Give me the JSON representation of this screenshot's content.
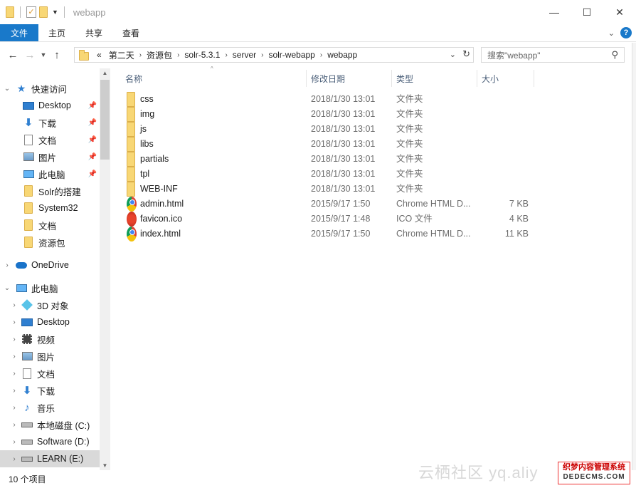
{
  "window": {
    "title": "webapp",
    "controls": {
      "minimize": "—",
      "maximize": "☐",
      "close": "✕"
    }
  },
  "ribbon": {
    "tabs": [
      "文件",
      "主页",
      "共享",
      "查看"
    ]
  },
  "address": {
    "overflow": "«",
    "path": [
      "第二天",
      "资源包",
      "solr-5.3.1",
      "server",
      "solr-webapp",
      "webapp"
    ]
  },
  "search": {
    "placeholder": "搜索\"webapp\""
  },
  "nav": {
    "quick_access": "快速访问",
    "quick_items": [
      {
        "label": "Desktop",
        "icon": "desktop-icon",
        "pinned": true
      },
      {
        "label": "下载",
        "icon": "download-icon",
        "pinned": true
      },
      {
        "label": "文档",
        "icon": "document-icon",
        "pinned": true
      },
      {
        "label": "图片",
        "icon": "pictures-icon",
        "pinned": true
      },
      {
        "label": "此电脑",
        "icon": "computer-icon",
        "pinned": true
      },
      {
        "label": "Solr的搭建",
        "icon": "folder-icon",
        "pinned": false
      },
      {
        "label": "System32",
        "icon": "folder-icon",
        "pinned": false
      },
      {
        "label": "文档",
        "icon": "folder-icon",
        "pinned": false
      },
      {
        "label": "资源包",
        "icon": "folder-icon",
        "pinned": false
      }
    ],
    "onedrive": "OneDrive",
    "this_pc": "此电脑",
    "pc_items": [
      {
        "label": "3D 对象",
        "icon": "3d-objects-icon"
      },
      {
        "label": "Desktop",
        "icon": "desktop-icon"
      },
      {
        "label": "视频",
        "icon": "video-icon"
      },
      {
        "label": "图片",
        "icon": "pictures-icon"
      },
      {
        "label": "文档",
        "icon": "document-icon"
      },
      {
        "label": "下载",
        "icon": "download-icon"
      },
      {
        "label": "音乐",
        "icon": "music-icon"
      },
      {
        "label": "本地磁盘 (C:)",
        "icon": "drive-icon"
      },
      {
        "label": "Software (D:)",
        "icon": "drive-icon"
      },
      {
        "label": "LEARN (E:)",
        "icon": "drive-icon"
      }
    ]
  },
  "columns": {
    "name": "名称",
    "date": "修改日期",
    "type": "类型",
    "size": "大小"
  },
  "files": [
    {
      "name": "css",
      "date": "2018/1/30 13:01",
      "type": "文件夹",
      "size": "",
      "icon": "folder-icon"
    },
    {
      "name": "img",
      "date": "2018/1/30 13:01",
      "type": "文件夹",
      "size": "",
      "icon": "folder-icon"
    },
    {
      "name": "js",
      "date": "2018/1/30 13:01",
      "type": "文件夹",
      "size": "",
      "icon": "folder-icon"
    },
    {
      "name": "libs",
      "date": "2018/1/30 13:01",
      "type": "文件夹",
      "size": "",
      "icon": "folder-icon"
    },
    {
      "name": "partials",
      "date": "2018/1/30 13:01",
      "type": "文件夹",
      "size": "",
      "icon": "folder-icon"
    },
    {
      "name": "tpl",
      "date": "2018/1/30 13:01",
      "type": "文件夹",
      "size": "",
      "icon": "folder-icon"
    },
    {
      "name": "WEB-INF",
      "date": "2018/1/30 13:01",
      "type": "文件夹",
      "size": "",
      "icon": "folder-icon"
    },
    {
      "name": "admin.html",
      "date": "2015/9/17 1:50",
      "type": "Chrome HTML D...",
      "size": "7 KB",
      "icon": "chrome-icon"
    },
    {
      "name": "favicon.ico",
      "date": "2015/9/17 1:48",
      "type": "ICO 文件",
      "size": "4 KB",
      "icon": "favicon-icon"
    },
    {
      "name": "index.html",
      "date": "2015/9/17 1:50",
      "type": "Chrome HTML D...",
      "size": "11 KB",
      "icon": "chrome-icon"
    }
  ],
  "status": {
    "item_count": "10 个项目"
  },
  "watermark": {
    "text": "云栖社区 yq.aliy",
    "brand_top": "织梦内容管理系统",
    "brand_bottom": "DEDECMS.COM"
  },
  "colors": {
    "accent": "#1979ca",
    "selection": "#cce8ff",
    "folder": "#f8d775"
  }
}
